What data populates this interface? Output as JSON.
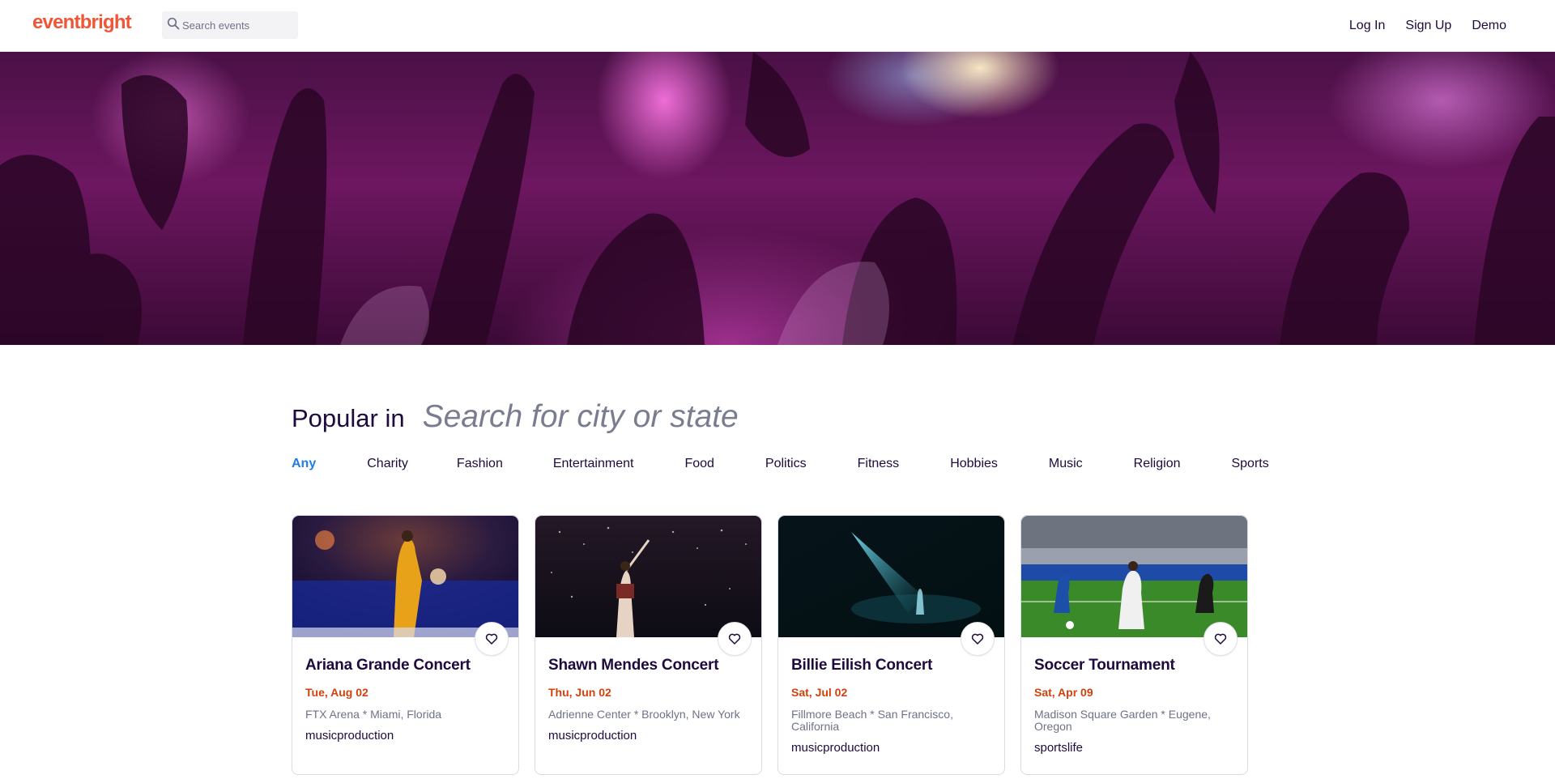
{
  "header": {
    "logo": "eventbright",
    "search_placeholder": "Search events",
    "nav": {
      "login": "Log In",
      "signup": "Sign Up",
      "demo": "Demo"
    }
  },
  "popular": {
    "label": "Popular in",
    "city_placeholder": "Search for city or state"
  },
  "categories": [
    "Any",
    "Charity",
    "Fashion",
    "Entertainment",
    "Food",
    "Politics",
    "Fitness",
    "Hobbies",
    "Music",
    "Religion",
    "Sports"
  ],
  "active_category": "Any",
  "events": [
    {
      "title": "Ariana Grande Concert",
      "date": "Tue, Aug 02",
      "location": "FTX Arena * Miami, Florida",
      "organizer": "musicproduction"
    },
    {
      "title": "Shawn Mendes Concert",
      "date": "Thu, Jun 02",
      "location": "Adrienne Center * Brooklyn, New York",
      "organizer": "musicproduction"
    },
    {
      "title": "Billie Eilish Concert",
      "date": "Sat, Jul 02",
      "location": "Fillmore Beach * San Francisco, California",
      "organizer": "musicproduction"
    },
    {
      "title": "Soccer Tournament",
      "date": "Sat, Apr 09",
      "location": "Madison Square Garden * Eugene, Oregon",
      "organizer": "sportslife"
    }
  ],
  "colors": {
    "brand": "#f05537",
    "active_category": "#1f7de8",
    "date": "#d1410c",
    "text": "#1e0a3c",
    "muted": "#6f7287"
  },
  "icons": {
    "search": "search-icon",
    "like": "heart-icon"
  }
}
